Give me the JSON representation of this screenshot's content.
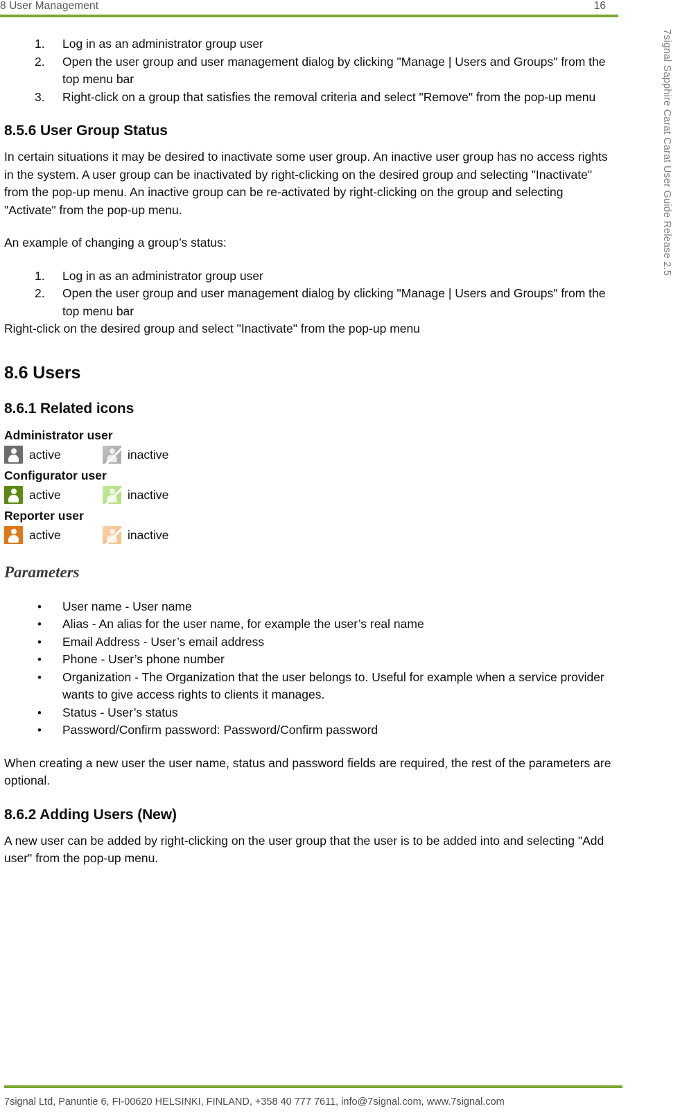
{
  "colors": {
    "accent_green": "#7BA832",
    "admin_icon": "#6E6E6E",
    "configurator_icon": "#5C8A15",
    "reporter_icon": "#DE7818",
    "header_text": "#585858"
  },
  "header": {
    "title": "8 User Management",
    "page_number": "16"
  },
  "side_banner": {
    "text": "7signal Sapphire Carat Carat User Guide Release 2.5"
  },
  "footer": {
    "text": "7signal Ltd, Panuntie 6, FI-00620 HELSINKI, FINLAND, +358 40 777 7611, info@7signal.com, www.7signal.com"
  },
  "content": {
    "steps_top": [
      {
        "num": "1.",
        "text": "Log in as an administrator group user"
      },
      {
        "num": "2.",
        "text": "Open the user group and user management dialog by clicking \"Manage | Users and Groups\" from the top menu bar"
      },
      {
        "num": "3.",
        "text": "Right-click on a group that satisfies the removal criteria and select \"Remove\" from the pop-up menu"
      }
    ],
    "section_856": {
      "heading": "8.5.6 User Group Status",
      "paragraph": "In certain situations it may be desired to inactivate some user group. An inactive user group has no access rights in the system. A user group can be inactivated by right-clicking on the desired group and selecting \"Inactivate\" from the pop-up menu. An inactive group can be re-activated by right-clicking on the group and selecting \"Activate\" from the pop-up menu.",
      "example_intro": "An example of changing a group’s status:",
      "steps": [
        {
          "num": "1.",
          "text": "Log in as an administrator group user"
        },
        {
          "num": "2.",
          "text": "Open the user group and user management dialog by clicking \"Manage | Users and Groups\" from the top menu bar"
        }
      ],
      "trailing_line": "Right-click on the desired group and select \"Inactivate\" from the pop-up menu"
    },
    "section_86": {
      "heading": "8.6 Users"
    },
    "section_861": {
      "heading": "8.6.1 Related icons",
      "icon_groups": [
        {
          "label": "Administrator user",
          "color": "#6E6E6E",
          "active_label": "active",
          "inactive_label": "inactive",
          "active_icon": "administrator-user-active-icon",
          "inactive_icon": "administrator-user-inactive-icon"
        },
        {
          "label": "Configurator user",
          "color": "#5C8A15",
          "active_label": "active",
          "inactive_label": "inactive",
          "active_icon": "configurator-user-active-icon",
          "inactive_icon": "configurator-user-inactive-icon"
        },
        {
          "label": "Reporter user",
          "color": "#DE7818",
          "active_label": "active",
          "inactive_label": "inactive",
          "active_icon": "reporter-user-active-icon",
          "inactive_icon": "reporter-user-inactive-icon"
        }
      ],
      "parameters_heading": "Parameters",
      "parameters": [
        "User name - User name",
        "Alias - An alias for the user name, for example the user’s real name",
        "Email Address - User’s email address",
        "Phone - User’s phone number",
        "Organization - The Organization that the user belongs to. Useful for example when a service provider wants to give access rights to clients it manages.",
        "Status - User’s status",
        "Password/Confirm password: Password/Confirm password"
      ],
      "closing_paragraph": "When creating a new user the user name, status and password fields are required, the rest of the parameters are optional."
    },
    "section_862": {
      "heading": "8.6.2 Adding Users (New)",
      "paragraph": "A new user can be added by right-clicking on the user group that the user is to be added into and selecting \"Add user\" from the pop-up menu."
    }
  }
}
